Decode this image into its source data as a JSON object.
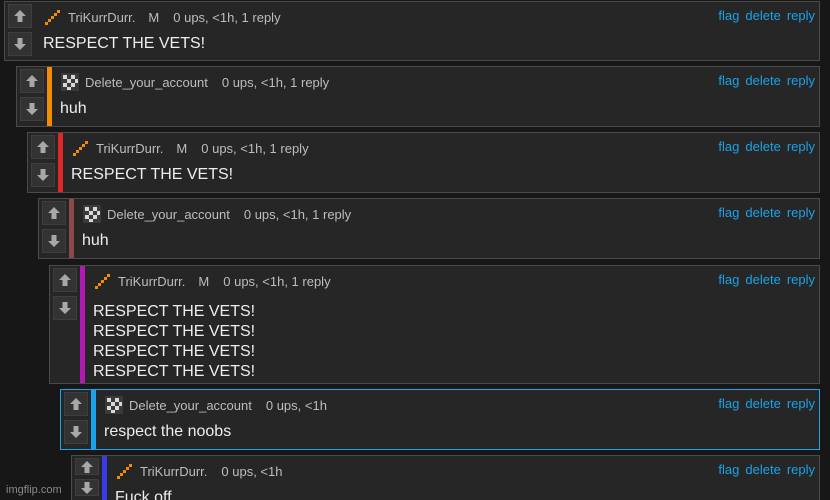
{
  "actions": {
    "flag": "flag",
    "delete": "delete",
    "reply": "reply"
  },
  "comments": [
    {
      "username": "TriKurrDurr.",
      "badge": "M",
      "meta": "0 ups, <1h, 1 reply",
      "lines": [
        "RESPECT THE VETS!"
      ],
      "bar_color": "",
      "icon": "stairs-icon"
    },
    {
      "username": "Delete_your_account",
      "badge": "",
      "meta": "0 ups, <1h, 1 reply",
      "lines": [
        "huh"
      ],
      "bar_color": "#f28c00",
      "icon": "pixel-avatar-icon"
    },
    {
      "username": "TriKurrDurr.",
      "badge": "M",
      "meta": "0 ups, <1h, 1 reply",
      "lines": [
        "RESPECT THE VETS!"
      ],
      "bar_color": "#e02828",
      "icon": "stairs-icon"
    },
    {
      "username": "Delete_your_account",
      "badge": "",
      "meta": "0 ups, <1h, 1 reply",
      "lines": [
        "huh"
      ],
      "bar_color": "#8a4a4a",
      "icon": "pixel-avatar-icon"
    },
    {
      "username": "TriKurrDurr.",
      "badge": "M",
      "meta": "0 ups, <1h, 1 reply",
      "lines": [
        "RESPECT THE VETS!",
        "RESPECT THE VETS!",
        "RESPECT THE VETS!",
        "RESPECT THE VETS!"
      ],
      "bar_color": "#b01ab5",
      "icon": "stairs-icon"
    },
    {
      "username": "Delete_your_account",
      "badge": "",
      "meta": "0 ups, <1h",
      "lines": [
        "respect the noobs"
      ],
      "bar_color": "#1aa3e8",
      "icon": "pixel-avatar-icon"
    },
    {
      "username": "TriKurrDurr.",
      "badge": "",
      "meta": "0 ups, <1h",
      "lines": [
        "Fuck off"
      ],
      "bar_color": "#3a3ae8",
      "icon": "stairs-icon"
    }
  ],
  "watermark": "imgflip.com"
}
